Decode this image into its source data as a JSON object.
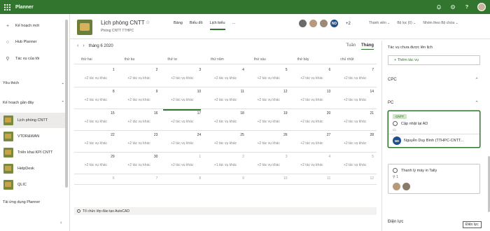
{
  "app": {
    "name": "Planner"
  },
  "nav": {
    "new_plan": "Kế hoạch mới",
    "hub": "Hub Planner",
    "my_tasks": "Tác vụ của tôi",
    "favorites": "Yêu thích",
    "recent": "Kế hoạch gần đây",
    "plans": [
      {
        "label": "Lịch phòng CNTT"
      },
      {
        "label": "VTDR&WAN"
      },
      {
        "label": "Triển khai KPI CNTT"
      },
      {
        "label": "HelpDesk"
      },
      {
        "label": "QLIC"
      }
    ],
    "bottom": "Tải ứng dụng Planner"
  },
  "plan": {
    "title": "Lịch phòng CNTT",
    "subtitle": "Phòng CNTT TTHPC",
    "views": [
      "Bảng",
      "Biểu đồ",
      "Lịch biểu"
    ],
    "more": "...",
    "member_initials": "ND",
    "member_more": "+2",
    "filters": [
      "Thành viên",
      "Bộ lọc (0)",
      "Nhóm theo Bộ chứa"
    ]
  },
  "calendar": {
    "month_label": "tháng 6 2020",
    "switch": [
      "Tuần",
      "Tháng"
    ],
    "weekdays": [
      "thứ hai",
      "thứ ba",
      "thứ tư",
      "thứ năm",
      "thứ sáu",
      "thứ bảy",
      "chủ nhật"
    ],
    "more_label": "+2 tác vụ khác",
    "more_label_alt": "+1 tác vụ khác",
    "rows": [
      [
        {
          "d": "1",
          "more": "+2 tác vụ khác"
        },
        {
          "d": "2",
          "more": "+2 tác vụ khác"
        },
        {
          "d": "3",
          "more": "+2 tác vụ khác"
        },
        {
          "d": "4",
          "more": "+2 tác vụ khác"
        },
        {
          "d": "5",
          "more": "+2 tác vụ khác"
        },
        {
          "d": "6",
          "more": "+2 tác vụ khác"
        },
        {
          "d": "7",
          "more": "+2 tác vụ khác"
        }
      ],
      [
        {
          "d": "8",
          "more": "+2 tác vụ khác"
        },
        {
          "d": "9",
          "more": "+2 tác vụ khác"
        },
        {
          "d": "10",
          "more": "+2 tác vụ khác"
        },
        {
          "d": "11",
          "more": "+2 tác vụ khác"
        },
        {
          "d": "12",
          "more": "+2 tác vụ khác"
        },
        {
          "d": "13",
          "more": "+2 tác vụ khác"
        },
        {
          "d": "14",
          "more": "+2 tác vụ khác"
        }
      ],
      [
        {
          "d": "15",
          "more": "+2 tác vụ khác"
        },
        {
          "d": "16",
          "more": "+2 tác vụ khác"
        },
        {
          "d": "17",
          "more": "+2 tác vụ khác",
          "today": true
        },
        {
          "d": "18",
          "more": "+2 tác vụ khác"
        },
        {
          "d": "19",
          "more": "+2 tác vụ khác"
        },
        {
          "d": "20",
          "more": "+2 tác vụ khác"
        },
        {
          "d": "21",
          "more": "+2 tác vụ khác"
        }
      ],
      [
        {
          "d": "22",
          "more": "+2 tác vụ khác"
        },
        {
          "d": "23",
          "more": "+2 tác vụ khác"
        },
        {
          "d": "24",
          "more": "+2 tác vụ khác"
        },
        {
          "d": "25",
          "more": "+2 tác vụ khác"
        },
        {
          "d": "26",
          "more": "+2 tác vụ khác"
        },
        {
          "d": "27",
          "more": "+2 tác vụ khác"
        },
        {
          "d": "28",
          "more": "+2 tác vụ khác"
        }
      ],
      [
        {
          "d": "29",
          "more": "+2 tác vụ khác"
        },
        {
          "d": "30",
          "more": "+2 tác vụ khác"
        },
        {
          "d": "1",
          "more": "+2 tác vụ khác",
          "dim": true
        },
        {
          "d": "2",
          "more": "+1 tác vụ khác",
          "dim": true
        },
        {
          "d": "3",
          "more": "+2 tác vụ khác",
          "dim": true
        },
        {
          "d": "4",
          "more": "+2 tác vụ khác",
          "dim": true
        },
        {
          "d": "5",
          "more": "+2 tác vụ khác",
          "dim": true
        }
      ],
      [
        {
          "d": "6",
          "dim": true
        },
        {
          "d": "7",
          "dim": true
        },
        {
          "d": "8",
          "dim": true
        },
        {
          "d": "9",
          "dim": true
        },
        {
          "d": "10",
          "dim": true
        },
        {
          "d": "11",
          "dim": true
        },
        {
          "d": "12",
          "dim": true
        }
      ]
    ],
    "bottom_task": "Tổ chức lớp đào tạo AutoCAD"
  },
  "right": {
    "title": "Tác vụ chưa được lên lịch",
    "add": "+ Thêm tác vụ",
    "sections": [
      "CPC",
      "PC",
      "Điện lực"
    ],
    "card1": {
      "tag": "CNTT",
      "task": "Cập nhật lại AD",
      "assignee": "Nguyễn Duy Bình (TTHPC-CNTT...",
      "initials": "ND"
    },
    "card2": {
      "task": "Thanh lý máy in Tally",
      "meta": "1"
    },
    "tooltip": "Điện lực"
  }
}
